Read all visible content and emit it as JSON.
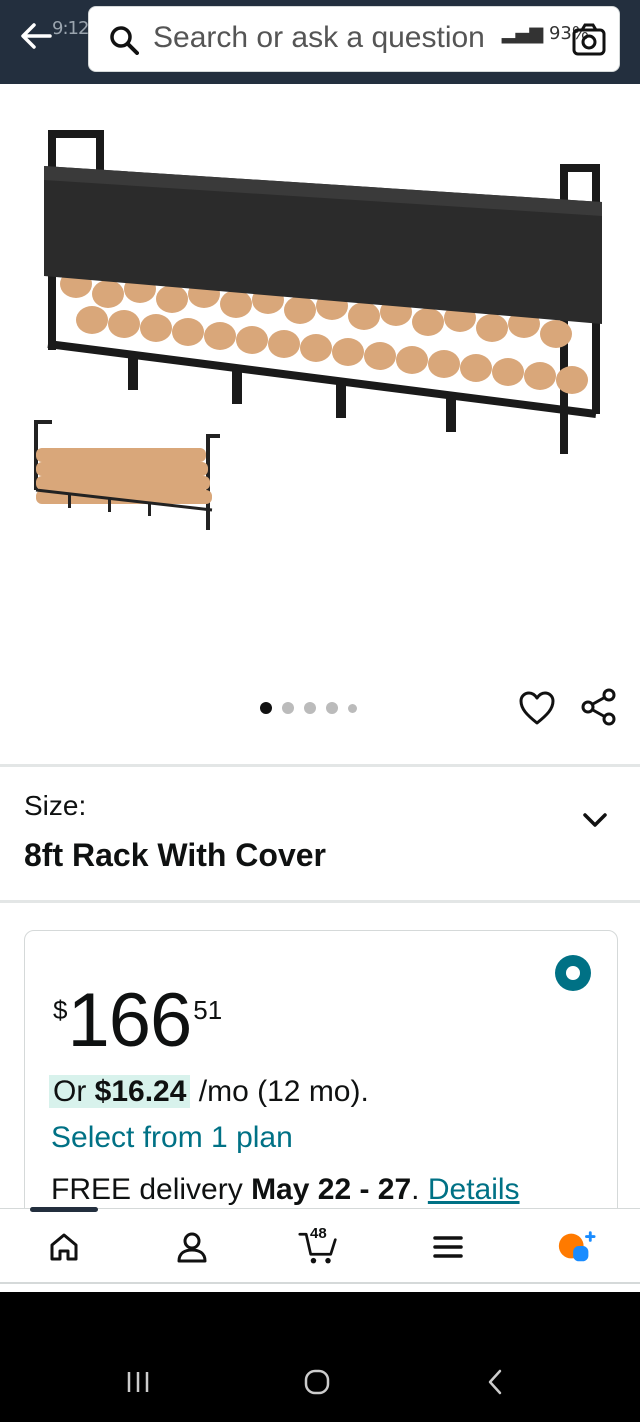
{
  "status_bar": {
    "time": "9:12",
    "battery": "93%"
  },
  "search": {
    "placeholder": "Search or ask a question"
  },
  "gallery": {
    "image_count": 5,
    "active_index": 0
  },
  "size": {
    "label": "Size:",
    "value": "8ft Rack With Cover"
  },
  "price": {
    "currency": "$",
    "whole": "166",
    "fraction": "51"
  },
  "installment": {
    "or": "Or",
    "amount": "$16.24",
    "term": "/mo (12 mo)."
  },
  "plan_link": "Select from 1 plan",
  "delivery": {
    "prefix": "FREE delivery",
    "date": "May 22 - 27",
    "separator": ".",
    "details": "Details"
  },
  "bottom_nav": {
    "cart_count": "48",
    "items": [
      "home-icon",
      "account-icon",
      "cart-icon",
      "menu-icon",
      "rufus-icon"
    ]
  },
  "colors": {
    "header": "#232f3e",
    "link": "#007185",
    "installment_highlight": "#d8f2ec"
  }
}
